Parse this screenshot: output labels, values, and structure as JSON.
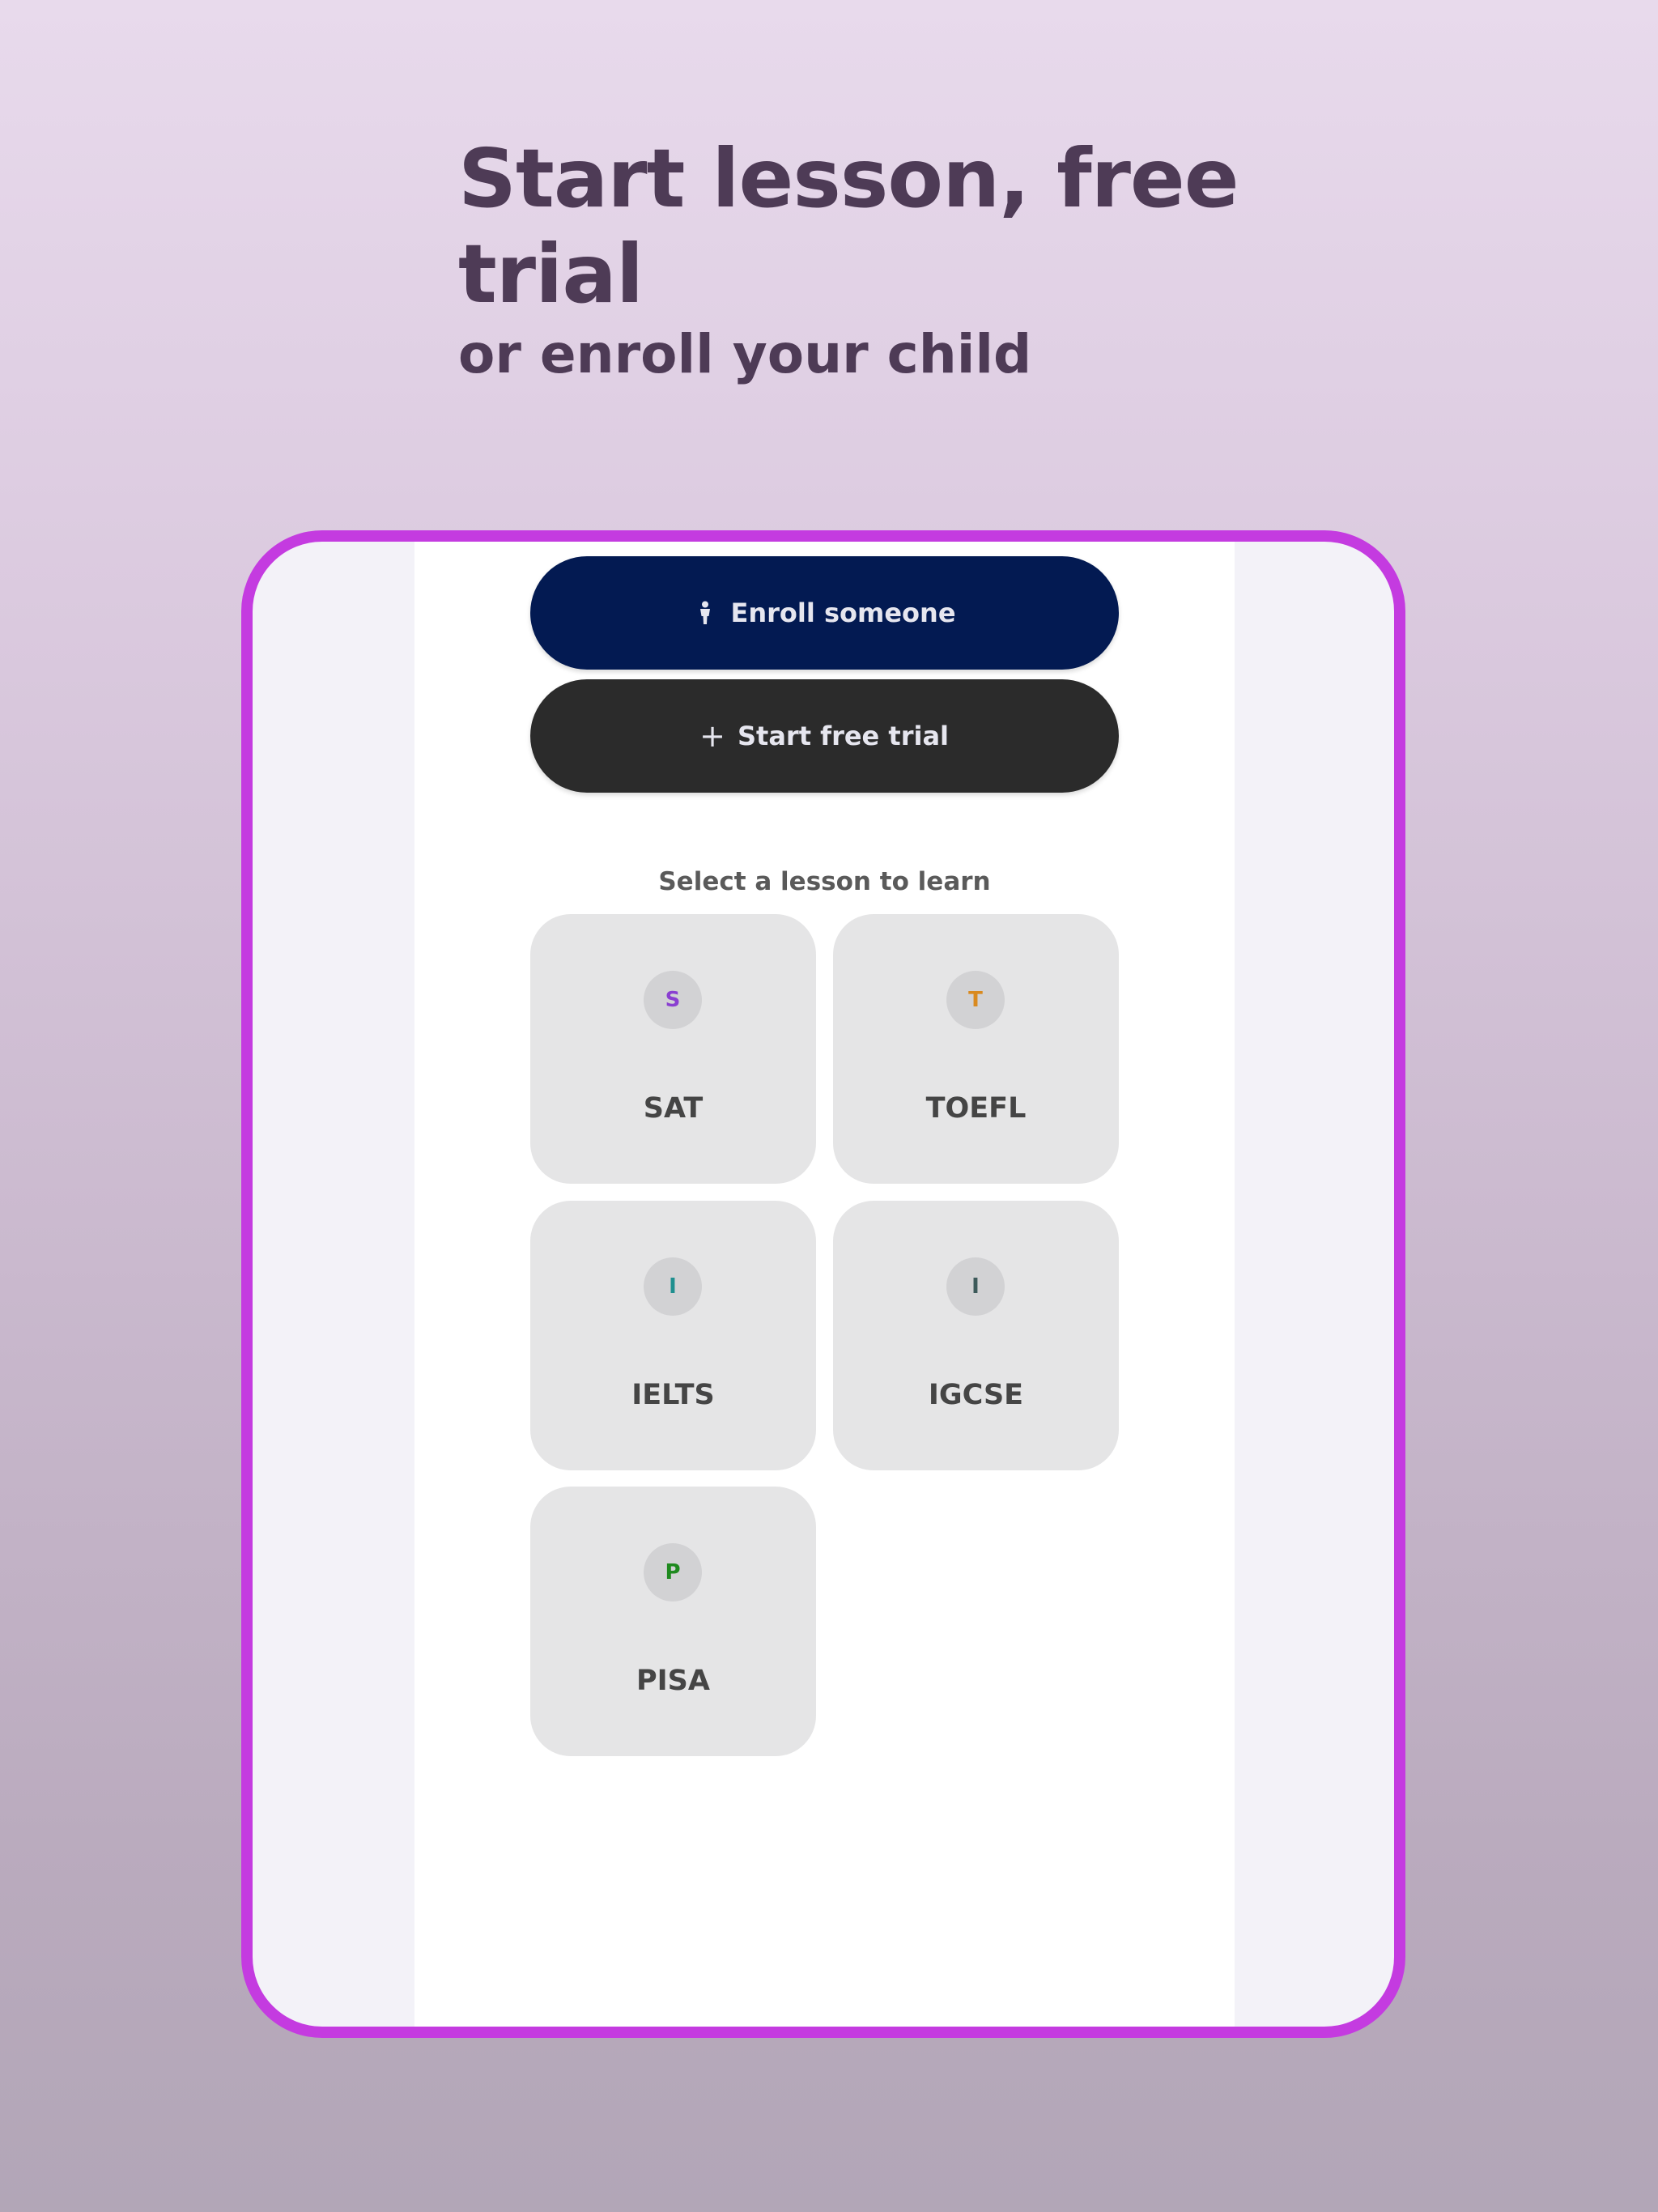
{
  "headline": {
    "title": "Start lesson, free trial",
    "subtitle": "or enroll your child"
  },
  "actions": {
    "enroll": {
      "label": "Enroll someone",
      "icon": "person-icon",
      "color": "#031a52"
    },
    "trial": {
      "label": "Start free trial",
      "icon": "plus-icon",
      "icon_glyph": "+",
      "color": "#2b2b2b"
    }
  },
  "lessons": {
    "section_label": "Select a lesson to learn",
    "items": [
      {
        "name": "SAT",
        "initial": "S",
        "initial_color": "#8a3fd1"
      },
      {
        "name": "TOEFL",
        "initial": "T",
        "initial_color": "#d98a1f"
      },
      {
        "name": "IELTS",
        "initial": "I",
        "initial_color": "#1f8f8f"
      },
      {
        "name": "IGCSE",
        "initial": "I",
        "initial_color": "#3d5a5a"
      },
      {
        "name": "PISA",
        "initial": "P",
        "initial_color": "#1f8a1f"
      }
    ]
  },
  "colors": {
    "frame_border": "#c43be0",
    "card_background": "#e5e5e6"
  }
}
